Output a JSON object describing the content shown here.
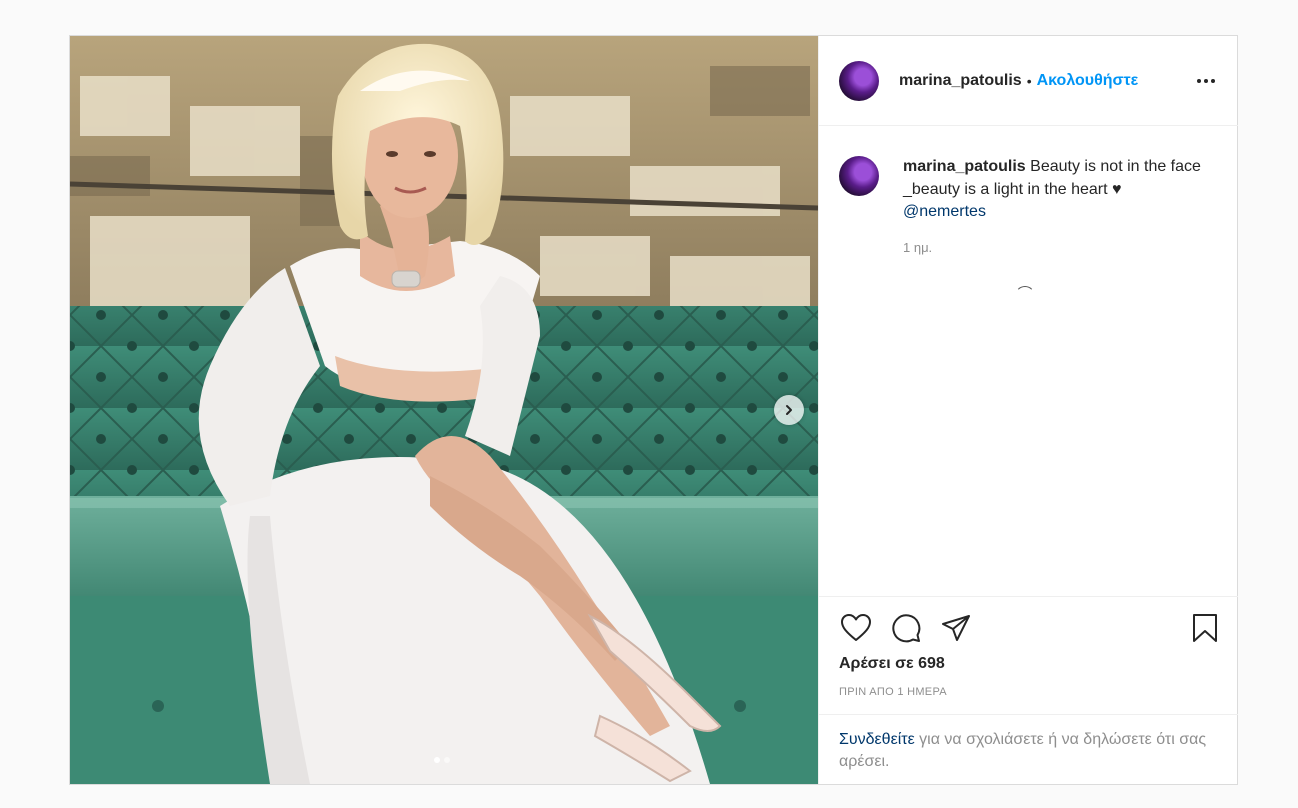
{
  "post": {
    "username": "marina_patoulis",
    "separator": "•",
    "follow_label": "Ακολουθήστε",
    "caption": {
      "username": "marina_patoulis",
      "text": " Beauty is not in the face _beauty is a light in the heart ♥ ",
      "mention": "@nemertes",
      "time": "1 ημ."
    },
    "likes_label": "Αρέσει σε 698",
    "timestamp": "ΠΡΙΝ ΑΠΟ 1 ΗΜΕΡΑ",
    "login_prompt": {
      "link": "Συνδεθείτε",
      "text": " για να σχολιάσετε ή να δηλώσετε ότι σας αρέσει."
    },
    "carousel": {
      "current": 1,
      "total": 2
    }
  },
  "icons": {
    "more": "more-options-icon",
    "like": "heart-icon",
    "comment": "comment-icon",
    "share": "share-icon",
    "save": "bookmark-icon",
    "next": "chevron-right-icon"
  },
  "colors": {
    "accent": "#0095f6",
    "link": "#00376b",
    "muted": "#8e8e8e",
    "border": "#dbdbdb"
  }
}
